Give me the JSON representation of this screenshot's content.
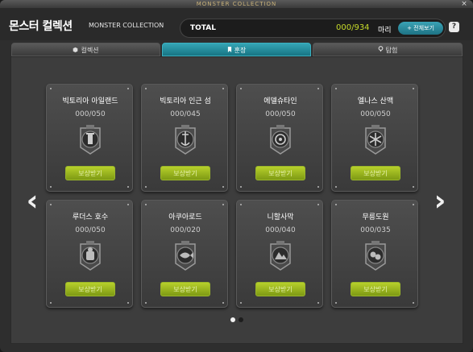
{
  "window": {
    "titlebar_text": "MONSTER COLLECTION",
    "close_label": "×"
  },
  "header": {
    "title": "몬스터 컬렉션",
    "subtitle": "MONSTER COLLECTION",
    "total_label": "TOTAL",
    "total_count": "000/934",
    "total_unit": "마리",
    "view_all_label": "+ 전체보기",
    "help_label": "?"
  },
  "tabs": [
    {
      "label": "컬렉션",
      "icon": "box-icon",
      "active": false
    },
    {
      "label": "훈장",
      "icon": "bookmark-icon",
      "active": true
    },
    {
      "label": "탐험",
      "icon": "pin-icon",
      "active": false
    }
  ],
  "nav": {
    "prev_label": "‹",
    "next_label": "›"
  },
  "cards": [
    {
      "name": "빅토리아 아일랜드",
      "count": "000/050",
      "button": "보상받기",
      "medal": "tower-medal-icon"
    },
    {
      "name": "빅토리아 인근 섬",
      "count": "000/045",
      "button": "보상받기",
      "medal": "anchor-medal-icon"
    },
    {
      "name": "에델슈타인",
      "count": "000/050",
      "button": "보상받기",
      "medal": "gear-medal-icon"
    },
    {
      "name": "엘나스 산맥",
      "count": "000/050",
      "button": "보상받기",
      "medal": "snowflake-medal-icon"
    },
    {
      "name": "루더스 호수",
      "count": "000/050",
      "button": "보상받기",
      "medal": "toy-medal-icon"
    },
    {
      "name": "아쿠아로드",
      "count": "000/020",
      "button": "보상받기",
      "medal": "fish-medal-icon"
    },
    {
      "name": "니할사막",
      "count": "000/040",
      "button": "보상받기",
      "medal": "desert-medal-icon"
    },
    {
      "name": "무릉도원",
      "count": "000/035",
      "button": "보상받기",
      "medal": "mulung-medal-icon"
    }
  ],
  "pagination": {
    "current": 1,
    "total": 2
  },
  "colors": {
    "accent": "#2a9bb0",
    "count": "#c8dc2a",
    "reward": "#a3c021"
  }
}
